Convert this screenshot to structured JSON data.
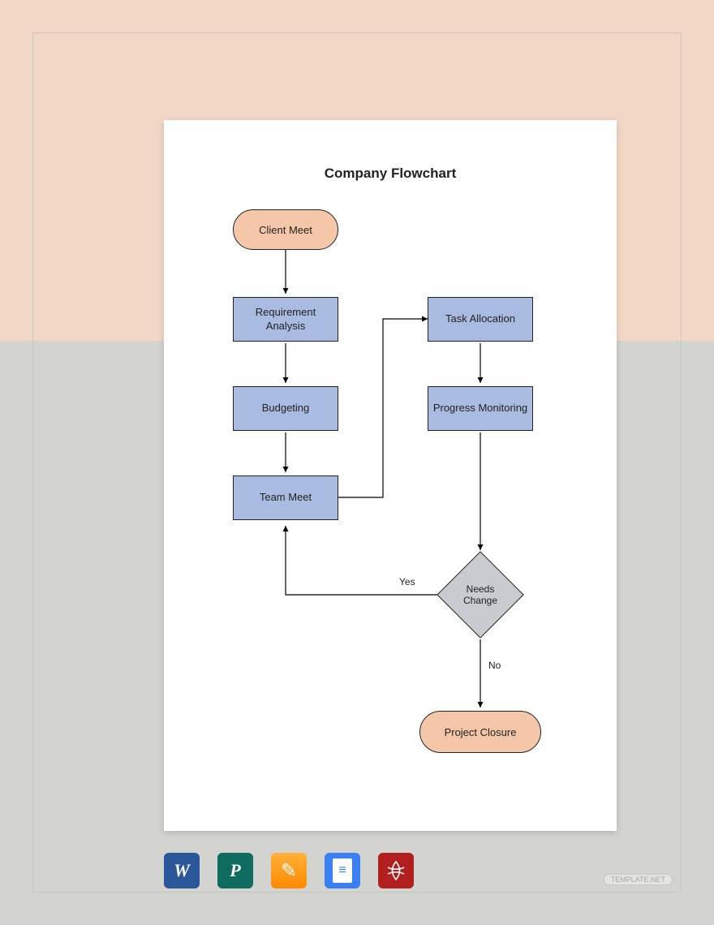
{
  "title": "Company Flowchart",
  "nodes": {
    "start": "Client Meet",
    "requirement": "Requirement Analysis",
    "budgeting": "Budgeting",
    "team_meet": "Team Meet",
    "task_alloc": "Task Allocation",
    "progress": "Progress Monitoring",
    "decision": "Needs Change",
    "end": "Project Closure"
  },
  "edges": {
    "yes": "Yes",
    "no": "No"
  },
  "apps": {
    "word": "W",
    "publisher": "P",
    "pages": "✎",
    "gdocs": "≡",
    "pdf": "A"
  },
  "watermark": "TEMPLATE.NET"
}
